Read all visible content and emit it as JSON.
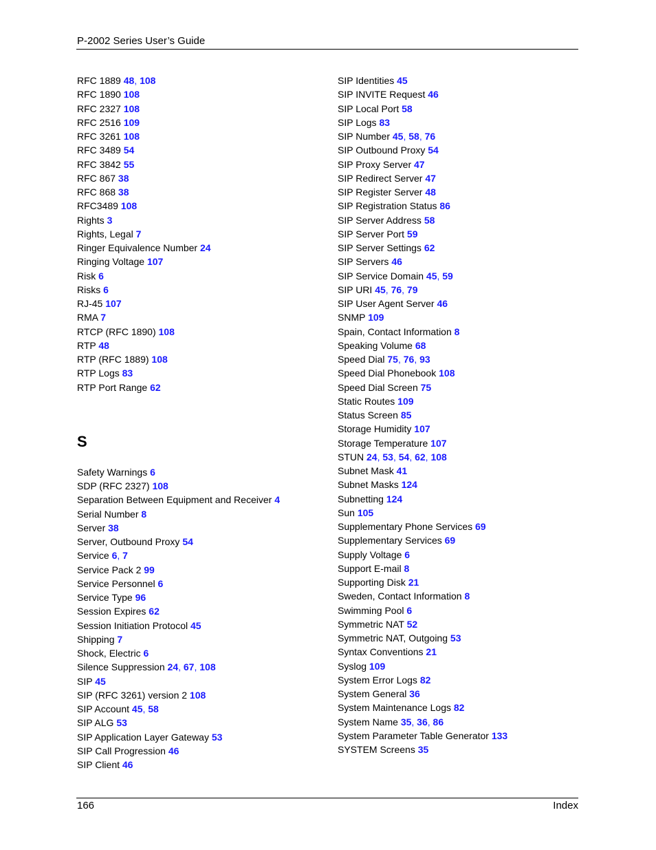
{
  "header": {
    "title": "P-2002 Series User’s Guide"
  },
  "footer": {
    "page_number": "166",
    "section": "Index"
  },
  "left_column": {
    "entries_r": [
      {
        "term": "RFC 1889",
        "pages": [
          "48",
          "108"
        ]
      },
      {
        "term": "RFC 1890",
        "pages": [
          "108"
        ]
      },
      {
        "term": "RFC 2327",
        "pages": [
          "108"
        ]
      },
      {
        "term": "RFC 2516",
        "pages": [
          "109"
        ]
      },
      {
        "term": "RFC 3261",
        "pages": [
          "108"
        ]
      },
      {
        "term": "RFC 3489",
        "pages": [
          "54"
        ]
      },
      {
        "term": "RFC 3842",
        "pages": [
          "55"
        ]
      },
      {
        "term": "RFC 867",
        "pages": [
          "38"
        ]
      },
      {
        "term": "RFC 868",
        "pages": [
          "38"
        ]
      },
      {
        "term": "RFC3489",
        "pages": [
          "108"
        ]
      },
      {
        "term": "Rights",
        "pages": [
          "3"
        ]
      },
      {
        "term": "Rights, Legal",
        "pages": [
          "7"
        ]
      },
      {
        "term": "Ringer Equivalence Number",
        "pages": [
          "24"
        ]
      },
      {
        "term": "Ringing Voltage",
        "pages": [
          "107"
        ]
      },
      {
        "term": "Risk",
        "pages": [
          "6"
        ]
      },
      {
        "term": "Risks",
        "pages": [
          "6"
        ]
      },
      {
        "term": "RJ-45",
        "pages": [
          "107"
        ]
      },
      {
        "term": "RMA",
        "pages": [
          "7"
        ]
      },
      {
        "term": "RTCP (RFC 1890)",
        "pages": [
          "108"
        ]
      },
      {
        "term": "RTP",
        "pages": [
          "48"
        ]
      },
      {
        "term": "RTP (RFC 1889)",
        "pages": [
          "108"
        ]
      },
      {
        "term": "RTP Logs",
        "pages": [
          "83"
        ]
      },
      {
        "term": "RTP Port Range",
        "pages": [
          "62"
        ]
      }
    ],
    "section_letter": "S",
    "entries_s": [
      {
        "term": "Safety Warnings",
        "pages": [
          "6"
        ]
      },
      {
        "term": "SDP (RFC 2327)",
        "pages": [
          "108"
        ]
      },
      {
        "term": "Separation Between Equipment and Receiver",
        "pages": [
          "4"
        ]
      },
      {
        "term": "Serial Number",
        "pages": [
          "8"
        ]
      },
      {
        "term": "Server",
        "pages": [
          "38"
        ]
      },
      {
        "term": "Server, Outbound Proxy",
        "pages": [
          "54"
        ]
      },
      {
        "term": "Service",
        "pages": [
          "6",
          "7"
        ]
      },
      {
        "term": "Service Pack 2",
        "pages": [
          "99"
        ]
      },
      {
        "term": "Service Personnel",
        "pages": [
          "6"
        ]
      },
      {
        "term": "Service Type",
        "pages": [
          "96"
        ]
      },
      {
        "term": "Session Expires",
        "pages": [
          "62"
        ]
      },
      {
        "term": "Session Initiation Protocol",
        "pages": [
          "45"
        ]
      },
      {
        "term": "Shipping",
        "pages": [
          "7"
        ]
      },
      {
        "term": "Shock, Electric",
        "pages": [
          "6"
        ]
      },
      {
        "term": "Silence Suppression",
        "pages": [
          "24",
          "67",
          "108"
        ]
      },
      {
        "term": "SIP",
        "pages": [
          "45"
        ]
      },
      {
        "term": "SIP (RFC 3261) version 2",
        "pages": [
          "108"
        ]
      },
      {
        "term": "SIP Account",
        "pages": [
          "45",
          "58"
        ]
      },
      {
        "term": "SIP ALG",
        "pages": [
          "53"
        ]
      },
      {
        "term": "SIP Application Layer Gateway",
        "pages": [
          "53"
        ]
      },
      {
        "term": "SIP Call Progression",
        "pages": [
          "46"
        ]
      },
      {
        "term": "SIP Client",
        "pages": [
          "46"
        ]
      }
    ]
  },
  "right_column": {
    "entries": [
      {
        "term": "SIP Identities",
        "pages": [
          "45"
        ]
      },
      {
        "term": "SIP INVITE Request",
        "pages": [
          "46"
        ]
      },
      {
        "term": "SIP Local Port",
        "pages": [
          "58"
        ]
      },
      {
        "term": "SIP Logs",
        "pages": [
          "83"
        ]
      },
      {
        "term": "SIP Number",
        "pages": [
          "45",
          "58",
          "76"
        ]
      },
      {
        "term": "SIP Outbound Proxy",
        "pages": [
          "54"
        ]
      },
      {
        "term": "SIP Proxy Server",
        "pages": [
          "47"
        ]
      },
      {
        "term": "SIP Redirect Server",
        "pages": [
          "47"
        ]
      },
      {
        "term": "SIP Register Server",
        "pages": [
          "48"
        ]
      },
      {
        "term": "SIP Registration Status",
        "pages": [
          "86"
        ]
      },
      {
        "term": "SIP Server Address",
        "pages": [
          "58"
        ]
      },
      {
        "term": "SIP Server Port",
        "pages": [
          "59"
        ]
      },
      {
        "term": "SIP Server Settings",
        "pages": [
          "62"
        ]
      },
      {
        "term": "SIP Servers",
        "pages": [
          "46"
        ]
      },
      {
        "term": "SIP Service Domain",
        "pages": [
          "45",
          "59"
        ]
      },
      {
        "term": "SIP URI",
        "pages": [
          "45",
          "76",
          "79"
        ]
      },
      {
        "term": "SIP User Agent Server",
        "pages": [
          "46"
        ]
      },
      {
        "term": "SNMP",
        "pages": [
          "109"
        ]
      },
      {
        "term": "Spain, Contact Information",
        "pages": [
          "8"
        ]
      },
      {
        "term": "Speaking Volume",
        "pages": [
          "68"
        ]
      },
      {
        "term": "Speed Dial",
        "pages": [
          "75",
          "76",
          "93"
        ]
      },
      {
        "term": "Speed Dial Phonebook",
        "pages": [
          "108"
        ]
      },
      {
        "term": "Speed Dial Screen",
        "pages": [
          "75"
        ]
      },
      {
        "term": "Static Routes",
        "pages": [
          "109"
        ]
      },
      {
        "term": "Status Screen",
        "pages": [
          "85"
        ]
      },
      {
        "term": "Storage Humidity",
        "pages": [
          "107"
        ]
      },
      {
        "term": "Storage Temperature",
        "pages": [
          "107"
        ]
      },
      {
        "term": "STUN",
        "pages": [
          "24",
          "53",
          "54",
          "62",
          "108"
        ]
      },
      {
        "term": "Subnet Mask",
        "pages": [
          "41"
        ]
      },
      {
        "term": "Subnet Masks",
        "pages": [
          "124"
        ]
      },
      {
        "term": "Subnetting",
        "pages": [
          "124"
        ]
      },
      {
        "term": "Sun",
        "pages": [
          "105"
        ]
      },
      {
        "term": "Supplementary Phone Services",
        "pages": [
          "69"
        ]
      },
      {
        "term": "Supplementary Services",
        "pages": [
          "69"
        ]
      },
      {
        "term": "Supply Voltage",
        "pages": [
          "6"
        ]
      },
      {
        "term": "Support E-mail",
        "pages": [
          "8"
        ]
      },
      {
        "term": "Supporting Disk",
        "pages": [
          "21"
        ]
      },
      {
        "term": "Sweden, Contact Information",
        "pages": [
          "8"
        ]
      },
      {
        "term": "Swimming Pool",
        "pages": [
          "6"
        ]
      },
      {
        "term": "Symmetric NAT",
        "pages": [
          "52"
        ]
      },
      {
        "term": "Symmetric NAT, Outgoing",
        "pages": [
          "53"
        ]
      },
      {
        "term": "Syntax Conventions",
        "pages": [
          "21"
        ]
      },
      {
        "term": "Syslog",
        "pages": [
          "109"
        ]
      },
      {
        "term": "System Error Logs",
        "pages": [
          "82"
        ]
      },
      {
        "term": "System General",
        "pages": [
          "36"
        ]
      },
      {
        "term": "System Maintenance Logs",
        "pages": [
          "82"
        ]
      },
      {
        "term": "System Name",
        "pages": [
          "35",
          "36",
          "86"
        ]
      },
      {
        "term": "System Parameter Table Generator",
        "pages": [
          "133"
        ]
      },
      {
        "term": "SYSTEM Screens",
        "pages": [
          "35"
        ]
      }
    ]
  }
}
